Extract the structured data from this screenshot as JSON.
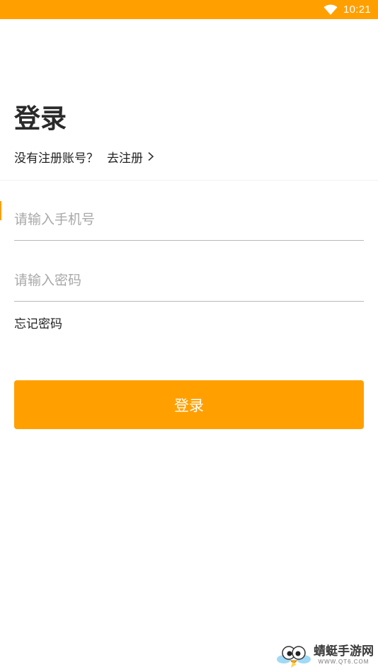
{
  "status_bar": {
    "time": "10:21",
    "wifi_icon": "wifi-icon",
    "background_color": "#ffa000"
  },
  "login": {
    "title": "登录",
    "no_account_text": "没有注册账号？",
    "register_link": "去注册",
    "register_icon": "chevron-right-icon",
    "phone_placeholder": "请输入手机号",
    "password_placeholder": "请输入密码",
    "forgot_password": "忘记密码",
    "submit_label": "登录"
  },
  "watermark": {
    "name": "蜻蜓手游网",
    "url": "WWW.QT6.COM"
  },
  "colors": {
    "accent": "#ffa000",
    "text": "#222222",
    "placeholder": "#a8a8a8",
    "divider": "#b8b8b8"
  }
}
